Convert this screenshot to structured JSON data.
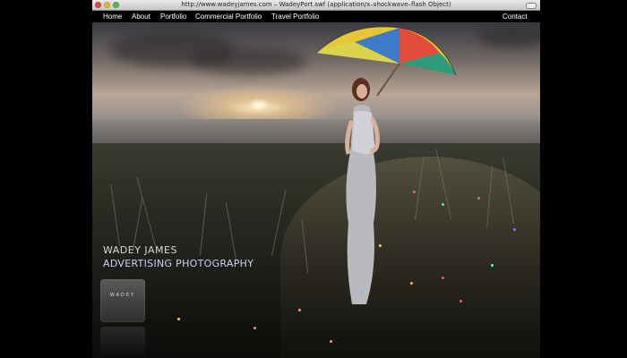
{
  "window": {
    "title": "http://www.wadeyjames.com – WadeyPort.swf (application/x–shockwave–flash Object)"
  },
  "nav": {
    "home": "Home",
    "about": "About",
    "portfolio": "Portfolio",
    "commercial_portfolio": "Commercial Portfolio",
    "travel_portfolio": "Travel Portfolio",
    "contact": "Contact"
  },
  "hero": {
    "name": "WADEY JAMES",
    "tagline": "ADVERTISING PHOTOGRAPHY"
  },
  "logo": {
    "text": "WADEY"
  },
  "colors": {
    "nav_text": "#ffffff",
    "tagline": "#c7d3f4",
    "background": "#000000"
  },
  "icons": [
    "close-light",
    "minimize-light",
    "zoom-light",
    "toolbar-toggle"
  ]
}
